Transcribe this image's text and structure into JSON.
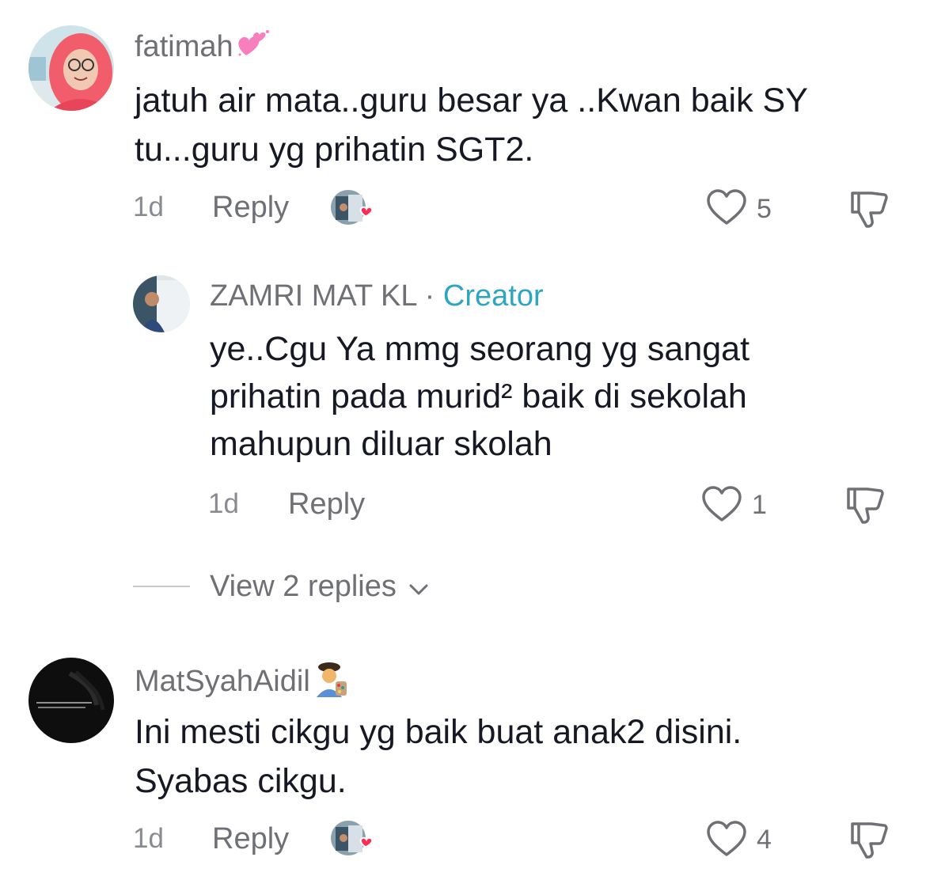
{
  "comments": [
    {
      "username": "fatimah",
      "username_emoji": "heart-sparkle-emoji",
      "text_lines": [
        "jatuh air mata..guru besar ya ..Kwan baik SY",
        "tu...guru yg prihatin SGT2."
      ],
      "time": "1d",
      "reply_label": "Reply",
      "likes": "5"
    },
    {
      "username": "MatSyahAidil",
      "username_emoji": "artist-emoji",
      "text_lines": [
        "Ini mesti cikgu yg baik buat anak2 disini.",
        "Syabas cikgu."
      ],
      "time": "1d",
      "reply_label": "Reply",
      "likes": "4"
    }
  ],
  "reply": {
    "username": "ZAMRI MAT KL",
    "separator": "·",
    "badge": "Creator",
    "text_lines": [
      "ye..Cgu Ya mmg seorang yg sangat",
      "prihatin pada murid² baik di sekolah",
      "mahupun diluar skolah"
    ],
    "time": "1d",
    "reply_label": "Reply",
    "likes": "1"
  },
  "view_replies": {
    "label": "View 2 replies"
  },
  "colors": {
    "creator_accent": "#2fa5c2",
    "heart_red": "#fe2c55",
    "secondary_text": "#6f7075"
  }
}
